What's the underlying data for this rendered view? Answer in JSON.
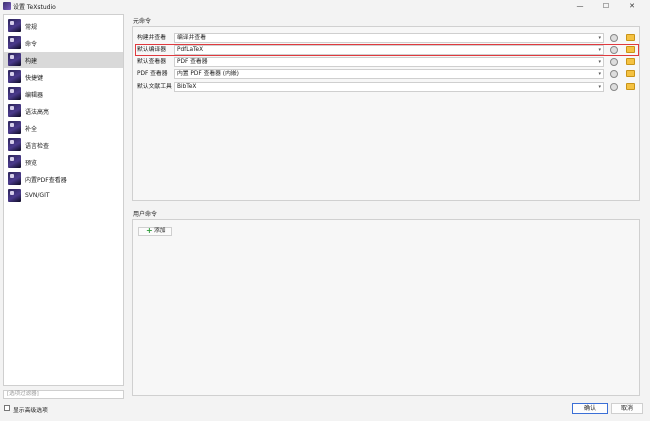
{
  "window": {
    "title": "设置 TeXstudio",
    "controls": {
      "minimize": "—",
      "maximize": "☐",
      "close": "✕"
    }
  },
  "sidebar": {
    "items": [
      {
        "label": "常规",
        "icon": "general-icon"
      },
      {
        "label": "命令",
        "icon": "commands-icon"
      },
      {
        "label": "构建",
        "icon": "build-icon",
        "selected": true
      },
      {
        "label": "快捷键",
        "icon": "shortcuts-icon"
      },
      {
        "label": "编辑器",
        "icon": "editor-icon"
      },
      {
        "label": "语法高亮",
        "icon": "syntax-highlight-icon"
      },
      {
        "label": "补全",
        "icon": "completion-icon"
      },
      {
        "label": "语言检查",
        "icon": "language-check-icon"
      },
      {
        "label": "预览",
        "icon": "preview-icon"
      },
      {
        "label": "内置PDF查看器",
        "icon": "pdf-viewer-icon"
      },
      {
        "label": "SVN/GIT",
        "icon": "svn-git-icon"
      }
    ],
    "filter_placeholder": "[选项过滤器]",
    "advanced_label": "显示高级选项",
    "advanced_checked": false
  },
  "meta_commands": {
    "title": "元命令",
    "rows": [
      {
        "label": "构建并查看",
        "value": "编译并查看",
        "highlighted": false
      },
      {
        "label": "默认编译器",
        "value": "PdfLaTeX",
        "highlighted": true
      },
      {
        "label": "默认查看器",
        "value": "PDF 查看器",
        "highlighted": false
      },
      {
        "label": "PDF 查看器",
        "value": "内置 PDF 查看器 (内嵌)",
        "highlighted": false
      },
      {
        "label": "默认文献工具",
        "value": "BibTeX",
        "highlighted": false
      }
    ]
  },
  "user_commands": {
    "title": "用户命令",
    "add_label": "添加"
  },
  "buttons": {
    "ok": "确认",
    "cancel": "取消"
  },
  "colors": {
    "highlight_border": "#e0393e",
    "ok_border": "#3b6fd6",
    "folder": "#f5c242",
    "add_plus": "#2e9b3a"
  }
}
